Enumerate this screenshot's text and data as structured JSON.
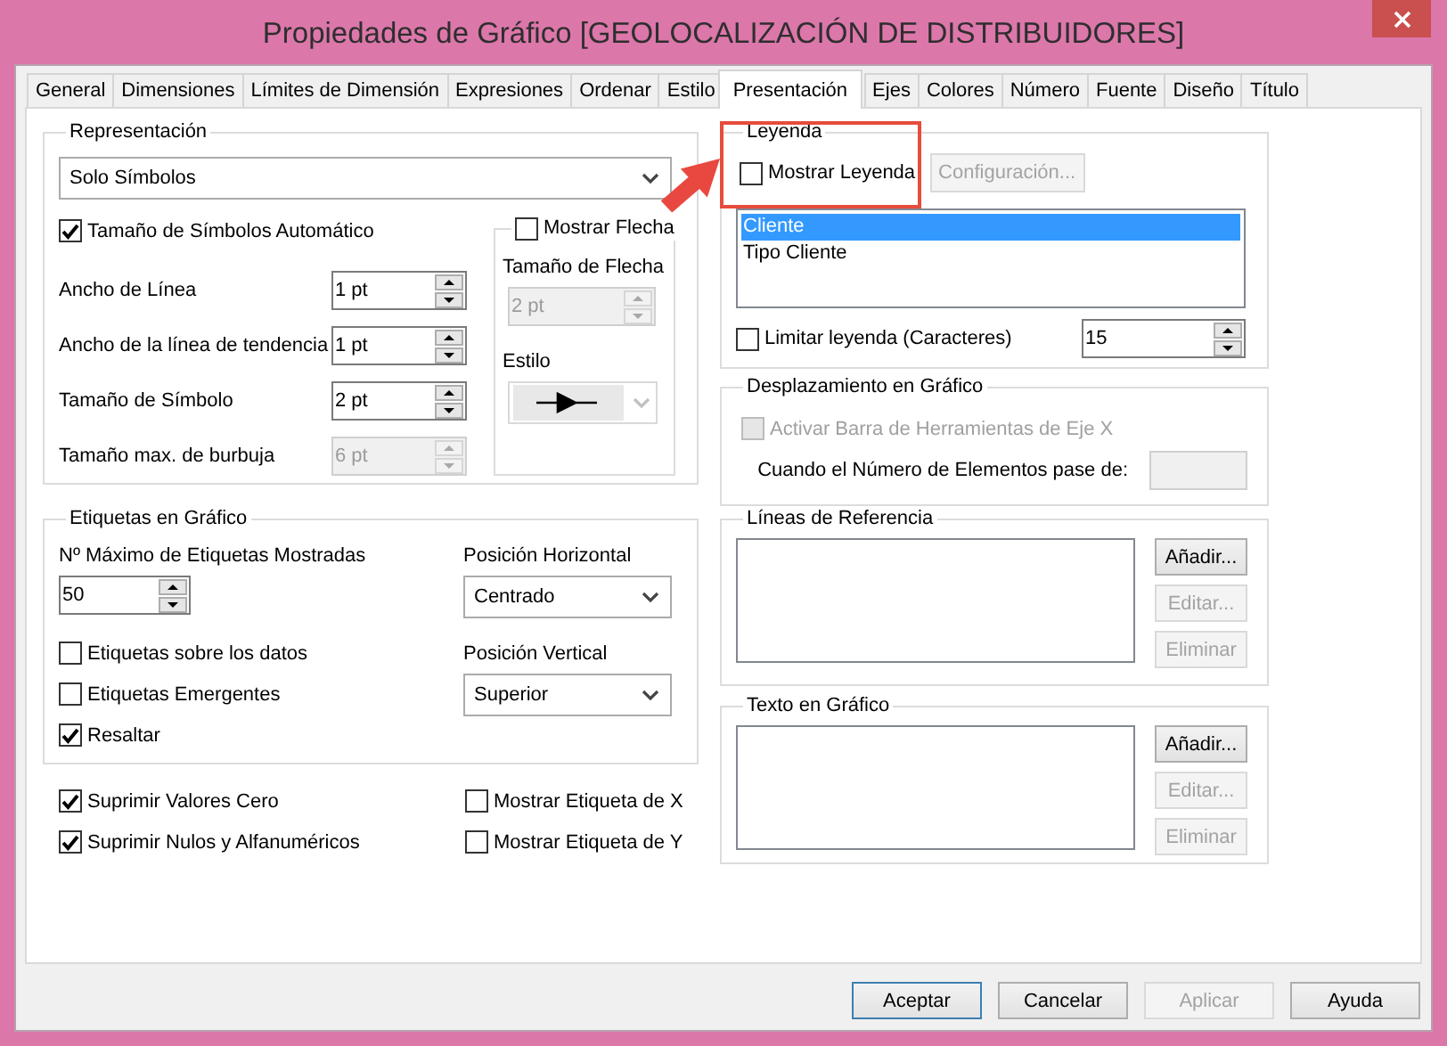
{
  "window": {
    "title": "Propiedades de Gráfico [GEOLOCALIZACIÓN DE DISTRIBUIDORES]"
  },
  "tabs": [
    {
      "label": "General",
      "selected": false
    },
    {
      "label": "Dimensiones",
      "selected": false
    },
    {
      "label": "Límites de Dimensión",
      "selected": false
    },
    {
      "label": "Expresiones",
      "selected": false
    },
    {
      "label": "Ordenar",
      "selected": false
    },
    {
      "label": "Estilo",
      "selected": false
    },
    {
      "label": "Presentación",
      "selected": true
    },
    {
      "label": "Ejes",
      "selected": false
    },
    {
      "label": "Colores",
      "selected": false
    },
    {
      "label": "Número",
      "selected": false
    },
    {
      "label": "Fuente",
      "selected": false
    },
    {
      "label": "Diseño",
      "selected": false
    },
    {
      "label": "Título",
      "selected": false
    }
  ],
  "representation": {
    "title": "Representación",
    "mode": "Solo Símbolos",
    "auto_size": {
      "label": "Tamaño de Símbolos Automático",
      "checked": true
    },
    "fields": [
      {
        "label": "Ancho de Línea",
        "value": "1 pt",
        "disabled": false
      },
      {
        "label": "Ancho de la línea de tendencia",
        "value": "1 pt",
        "disabled": false
      },
      {
        "label": "Tamaño de Símbolo",
        "value": "2 pt",
        "disabled": false
      },
      {
        "label": "Tamaño max. de burbuja",
        "value": "6 pt",
        "disabled": true
      }
    ],
    "arrows": {
      "label": "Mostrar Flecha",
      "checked": false,
      "size_label": "Tamaño de Flecha",
      "size_value": "2 pt",
      "style_label": "Estilo",
      "disabled": true
    }
  },
  "labels": {
    "title": "Etiquetas en Gráfico",
    "max_label": "Nº Máximo de Etiquetas Mostradas",
    "max_value": "50",
    "options": [
      {
        "label": "Etiquetas sobre los datos",
        "checked": false
      },
      {
        "label": "Etiquetas Emergentes",
        "checked": false
      },
      {
        "label": "Resaltar",
        "checked": true
      }
    ],
    "positions": [
      {
        "label": "Posición Horizontal",
        "value": "Centrado"
      },
      {
        "label": "Posición Vertical",
        "value": "Superior"
      }
    ]
  },
  "bottom_options": [
    {
      "label": "Suprimir Valores Cero",
      "checked": true
    },
    {
      "label": "Mostrar Etiqueta de X",
      "checked": false
    },
    {
      "label": "Suprimir Nulos y Alfanuméricos",
      "checked": true
    },
    {
      "label": "Mostrar Etiqueta de Y",
      "checked": false
    }
  ],
  "legend": {
    "title": "Leyenda",
    "show": {
      "label": "Mostrar Leyenda",
      "checked": false
    },
    "config_button": {
      "label": "Configuración...",
      "disabled": true
    },
    "items": [
      {
        "label": "Cliente",
        "selected": true
      },
      {
        "label": "Tipo Cliente",
        "selected": false
      }
    ],
    "limit": {
      "label": "Limitar leyenda (Caracteres)",
      "checked": false,
      "value": "15"
    }
  },
  "scroll": {
    "title": "Desplazamiento en Gráfico",
    "toolbar": {
      "label": "Activar Barra de Herramientas de Eje X",
      "checked": false,
      "disabled": true
    },
    "threshold_label": "Cuando el Número de Elementos pase de:"
  },
  "reference_lines": {
    "title": "Líneas de Referencia",
    "buttons": [
      {
        "label": "Añadir...",
        "disabled": false
      },
      {
        "label": "Editar...",
        "disabled": true
      },
      {
        "label": "Eliminar",
        "disabled": true
      }
    ]
  },
  "chart_text": {
    "title": "Texto en Gráfico",
    "buttons": [
      {
        "label": "Añadir...",
        "disabled": false
      },
      {
        "label": "Editar...",
        "disabled": true
      },
      {
        "label": "Eliminar",
        "disabled": true
      }
    ]
  },
  "dialog_buttons": [
    {
      "label": "Aceptar",
      "default": true,
      "disabled": false
    },
    {
      "label": "Cancelar",
      "default": false,
      "disabled": false
    },
    {
      "label": "Aplicar",
      "default": false,
      "disabled": true
    },
    {
      "label": "Ayuda",
      "default": false,
      "disabled": false
    }
  ]
}
